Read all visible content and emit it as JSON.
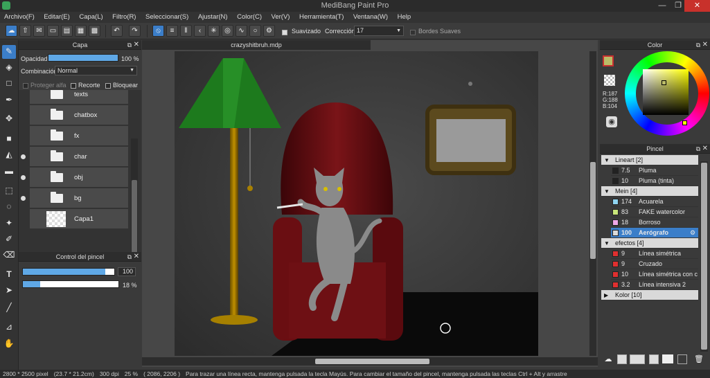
{
  "window": {
    "title": "MediBang Paint Pro",
    "minimize": "—",
    "maximize": "❐",
    "close": "✕"
  },
  "menu": [
    "Archivo(F)",
    "Editar(E)",
    "Capa(L)",
    "Filtro(R)",
    "Seleccionar(S)",
    "Ajustar(N)",
    "Color(C)",
    "Ver(V)",
    "Herramienta(T)",
    "Ventana(W)",
    "Help"
  ],
  "toolbar": {
    "smooth_label": "Suavizado",
    "correction_label": "Corrección",
    "correction_value": "17",
    "soft_edges_label": "Bordes Suaves"
  },
  "layer_panel": {
    "title": "Capa",
    "opacity_label": "Opacidad",
    "opacity_value": "100 %",
    "opacity_fraction": 1.0,
    "blend_label": "Combinación",
    "blend_value": "Normal",
    "protect_alpha": "Proteger alfa",
    "clipping": "Recorte",
    "lock": "Bloquear",
    "layers": [
      {
        "name": "texts",
        "type": "folder",
        "visible": false
      },
      {
        "name": "chatbox",
        "type": "folder",
        "visible": false
      },
      {
        "name": "fx",
        "type": "folder",
        "visible": false
      },
      {
        "name": "char",
        "type": "folder",
        "visible": true
      },
      {
        "name": "obj",
        "type": "folder",
        "visible": true
      },
      {
        "name": "bg",
        "type": "folder",
        "visible": true
      },
      {
        "name": "Capa1",
        "type": "layer",
        "visible": false
      }
    ]
  },
  "brush_control": {
    "title": "Control del pincel",
    "size_value": "100",
    "size_fraction": 0.9,
    "opacity_value": "18 %",
    "opacity_fraction": 0.18
  },
  "canvas": {
    "doc_tab": "crazyshitbruh.mdp"
  },
  "color_panel": {
    "title": "Color",
    "r": "R:187",
    "g": "G:188",
    "b": "B:104",
    "primary_color": "#bbbc68"
  },
  "brush_panel": {
    "title": "Pincel",
    "groups": [
      {
        "name": "Lineart [2]",
        "items": [
          {
            "size": "7.5",
            "name": "Pluma",
            "color": "#222222"
          },
          {
            "size": "10",
            "name": "Pluma (tinta)",
            "color": "#222222"
          }
        ]
      },
      {
        "name": "Mein [4]",
        "items": [
          {
            "size": "174",
            "name": "Acuarela",
            "color": "#8fd4f0"
          },
          {
            "size": "83",
            "name": "FAKE watercolor",
            "color": "#c8e67a"
          },
          {
            "size": "18",
            "name": "Borroso",
            "color": "#f0a8e8"
          },
          {
            "size": "100",
            "name": "Aerógrafo",
            "color": "#d9d9d9",
            "selected": true
          }
        ]
      },
      {
        "name": "efectos [4]",
        "items": [
          {
            "size": "9",
            "name": "Línea simétrica",
            "color": "#e03030"
          },
          {
            "size": "9",
            "name": "Cruzado",
            "color": "#e03030"
          },
          {
            "size": "10",
            "name": "Línea simétrica con c",
            "color": "#e03030"
          },
          {
            "size": "3.2",
            "name": "Línea intensiva 2",
            "color": "#e03030"
          }
        ]
      },
      {
        "name": "Kolor [10]",
        "items": []
      }
    ]
  },
  "status": {
    "size": "2800 * 2500 pixel",
    "cm": "(23.7 * 21.2cm)",
    "dpi": "300 dpi",
    "zoom": "25 %",
    "coords": "( 2086, 2206 )",
    "hint": "Para trazar una línea recta, mantenga pulsada la tecla Mayús. Para cambiar el tamaño del pincel, mantenga pulsada las teclas Ctrl + Alt y arrastre"
  }
}
